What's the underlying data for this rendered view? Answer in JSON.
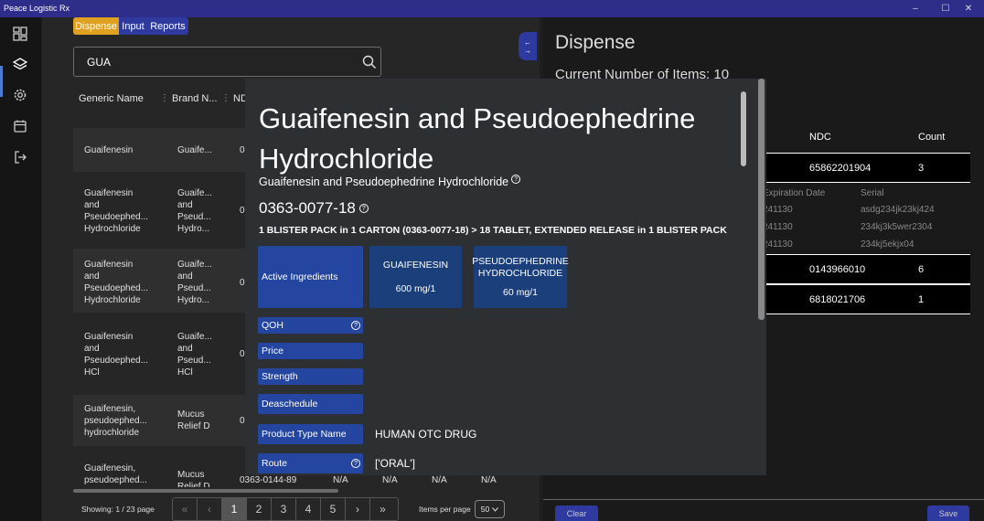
{
  "app": {
    "title": "Peace Logistic Rx"
  },
  "window_controls": {
    "minimize": "–",
    "maximize": "☐",
    "close": "✕"
  },
  "tabs": {
    "dispense": "Dispense",
    "input": "Input",
    "reports": "Reports"
  },
  "search": {
    "value": "GUA"
  },
  "table": {
    "headers": {
      "generic": "Generic Name",
      "brand": "Brand N...",
      "ndc": "ND"
    },
    "rows": [
      {
        "generic": "Guaifenesin",
        "brand": "Guaife...",
        "ndc": "0"
      },
      {
        "generic": "Guaifenesin\nand\nPseudoephed...\nHydrochloride",
        "brand": "Guaife...\nand\nPseud...\nHydro...",
        "ndc": "0"
      },
      {
        "generic": "Guaifenesin\nand\nPseudoephed...\nHydrochloride",
        "brand": "Guaife...\nand\nPseud...\nHydro...",
        "ndc": "0"
      },
      {
        "generic": "Guaifenesin\nand\nPseudoephed...\nHCl",
        "brand": "Guaife...\nand\nPseud...\nHCl",
        "ndc": "0"
      },
      {
        "generic": "Guaifenesin,\npseudoephed...\nhydrochloride",
        "brand": "Mucus\nRelief D",
        "ndc": "0"
      },
      {
        "generic": "Guaifenesin,\npseudoephed...",
        "brand": "Mucus\nRelief D",
        "ndc": "0363-0144-89",
        "c1": "N/A",
        "c2": "N/A",
        "c3": "N/A",
        "c4": "N/A"
      }
    ]
  },
  "pager": {
    "showing": "Showing: 1 / 23 page",
    "first": "«",
    "prev": "‹",
    "pages": [
      "1",
      "2",
      "3",
      "4",
      "5"
    ],
    "next": "›",
    "last": "»",
    "items_per_page_label": "Items per page",
    "items_per_page_value": "50"
  },
  "modal": {
    "title": "Guaifenesin and Pseudoephedrine Hydrochloride",
    "subtitle": "Guaifenesin and Pseudoephedrine Hydrochloride",
    "ndc": "0363-0077-18",
    "package": "1 BLISTER PACK in 1 CARTON (0363-0077-18) > 18 TABLET, EXTENDED RELEASE in 1 BLISTER PACK",
    "active_ingredients_label": "Active Ingredients",
    "ingredients": [
      {
        "name": "GUAIFENESIN",
        "strength": "600 mg/1"
      },
      {
        "name": "PSEUDOEPHEDRINE HYDROCHLORIDE",
        "strength": "60 mg/1"
      }
    ],
    "fields": {
      "qoh": "QOH",
      "price": "Price",
      "strength": "Strength",
      "deaschedule": "Deaschedule",
      "product_type_label": "Product Type Name",
      "product_type_value": "HUMAN OTC DRUG",
      "route_label": "Route",
      "route_value": "['ORAL']"
    },
    "help_glyph": "?"
  },
  "dispense": {
    "title": "Dispense",
    "count_label": "Current Number of Items: 10",
    "headers": {
      "ndc": "NDC",
      "count": "Count"
    },
    "items": [
      {
        "ndc": "65862201904",
        "count": "3"
      },
      {
        "ndc": "0143966010",
        "count": "6"
      },
      {
        "ndc": "6818021706",
        "count": "1"
      }
    ],
    "sub_headers": {
      "expiration": "Expiration Date",
      "serial": "Serial"
    },
    "sub_rows": [
      {
        "exp": "241130",
        "serial": "asdg234jk23kj424"
      },
      {
        "exp": "241130",
        "serial": "234kj3k5wer2304"
      },
      {
        "exp": "241130",
        "serial": "234kj5ekjx04"
      }
    ],
    "clear": "Clear",
    "save": "Save"
  }
}
